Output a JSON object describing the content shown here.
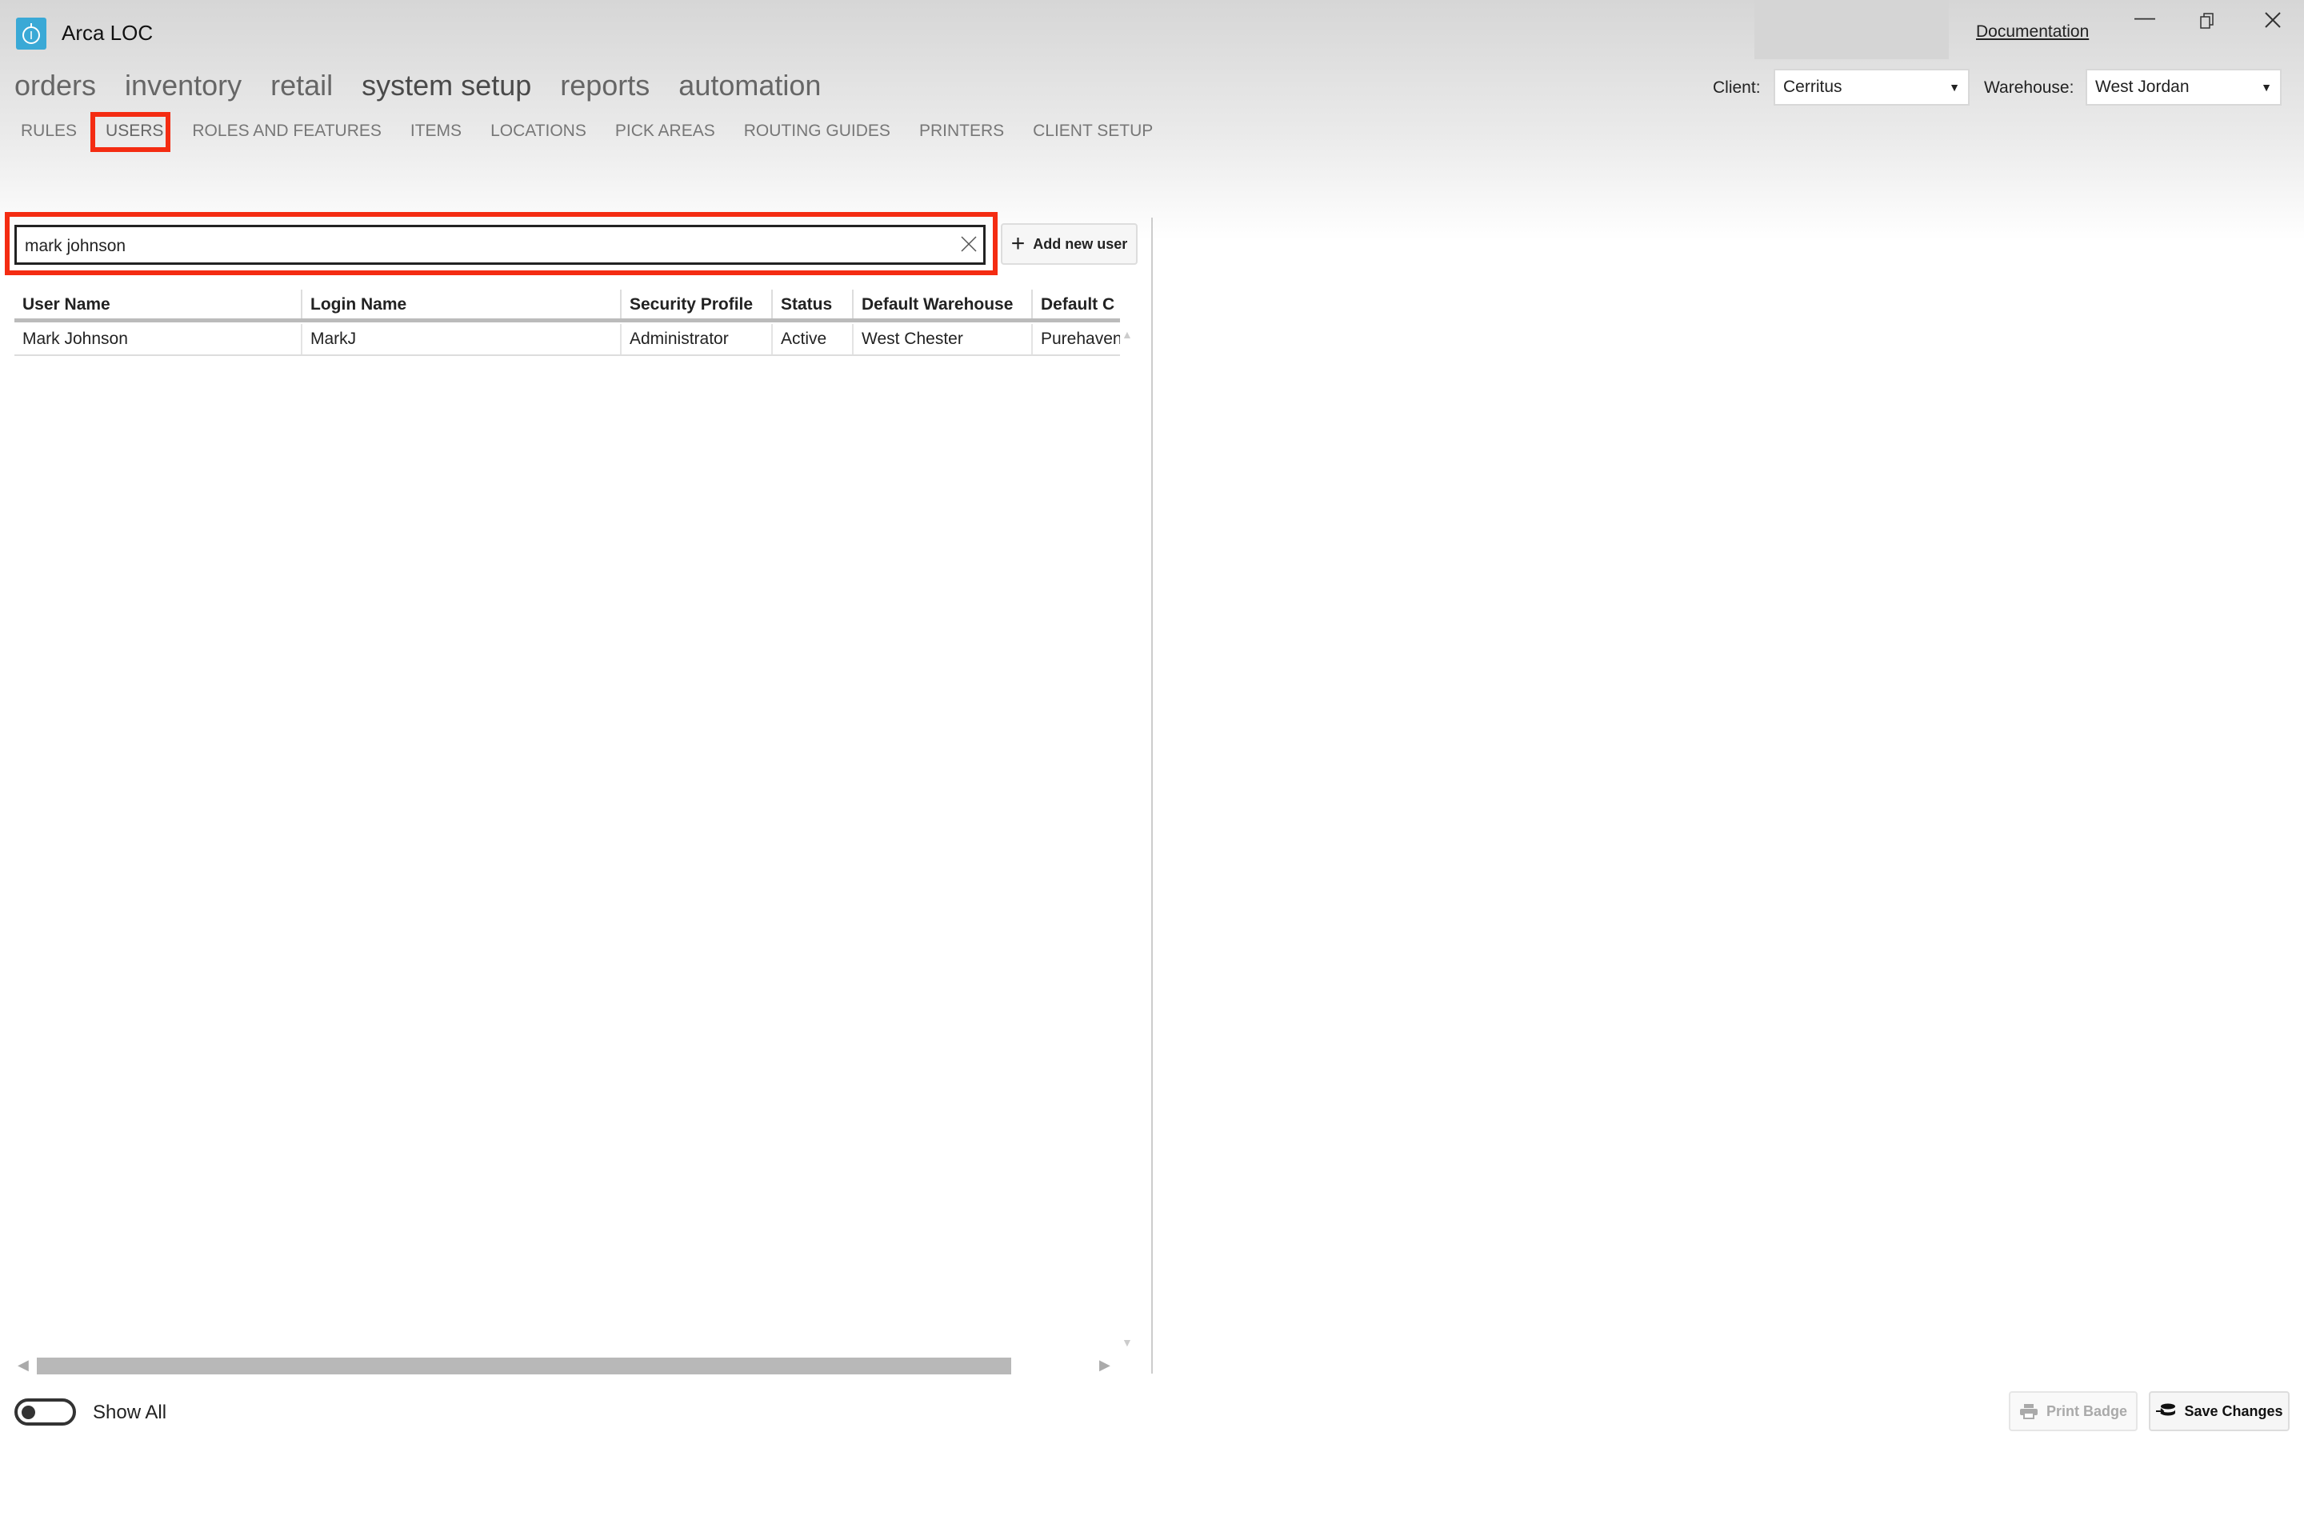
{
  "app": {
    "title": "Arca LOC",
    "documentation": "Documentation"
  },
  "main_nav": [
    {
      "label": "orders"
    },
    {
      "label": "inventory"
    },
    {
      "label": "retail"
    },
    {
      "label": "system setup",
      "active": true
    },
    {
      "label": "reports"
    },
    {
      "label": "automation"
    }
  ],
  "sub_nav": [
    {
      "label": "RULES"
    },
    {
      "label": "USERS",
      "active": true
    },
    {
      "label": "ROLES AND FEATURES"
    },
    {
      "label": "ITEMS"
    },
    {
      "label": "LOCATIONS"
    },
    {
      "label": "PICK AREAS"
    },
    {
      "label": "ROUTING GUIDES"
    },
    {
      "label": "PRINTERS"
    },
    {
      "label": "CLIENT SETUP"
    }
  ],
  "filters": {
    "client_label": "Client:",
    "client_value": "Cerritus",
    "warehouse_label": "Warehouse:",
    "warehouse_value": "West Jordan"
  },
  "search": {
    "value": "mark johnson"
  },
  "add_user_label": "Add new user",
  "table": {
    "columns": [
      "User Name",
      "Login Name",
      "Security Profile",
      "Status",
      "Default Warehouse",
      "Default C"
    ],
    "rows": [
      [
        "Mark Johnson",
        "MarkJ",
        "Administrator",
        "Active",
        "West Chester",
        "Purehaven"
      ]
    ]
  },
  "show_all": {
    "label": "Show All",
    "on": false
  },
  "footer": {
    "print_badge": "Print Badge",
    "save_changes": "Save Changes"
  },
  "colors": {
    "highlight": "#f42c12",
    "logo": "#3aa9d6"
  }
}
